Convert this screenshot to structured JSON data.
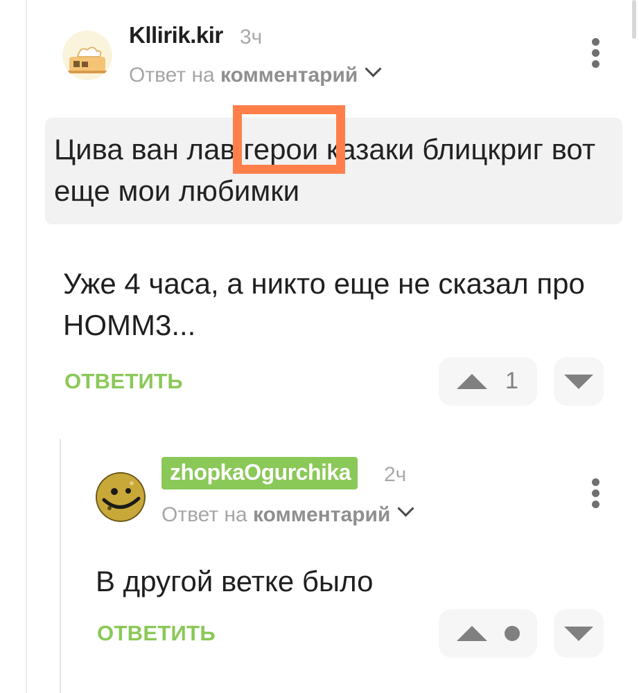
{
  "comment1": {
    "username": "Kllirik.kir",
    "time": "3ч",
    "reply_prefix": "Ответ на",
    "reply_target": "комментарий",
    "quote": "Цива ван лав герои казаки блицкриг вот еще мои любимки",
    "quote_highlight": "герои",
    "body": "Уже 4 часа, а никто еще не сказал про HOMM3...",
    "reply_label": "ОТВЕТИТЬ",
    "vote_count": "1"
  },
  "comment2": {
    "username": "zhopkaOgurchika",
    "time": "2ч",
    "reply_prefix": "Ответ на",
    "reply_target": "комментарий",
    "body": "В другой ветке было",
    "reply_label": "ОТВЕТИТЬ"
  },
  "colors": {
    "accent_green": "#8ac858",
    "highlight_orange": "#ff7f4a",
    "quote_bg": "#f2f2f2",
    "vote_bg": "#f6f6f6"
  }
}
